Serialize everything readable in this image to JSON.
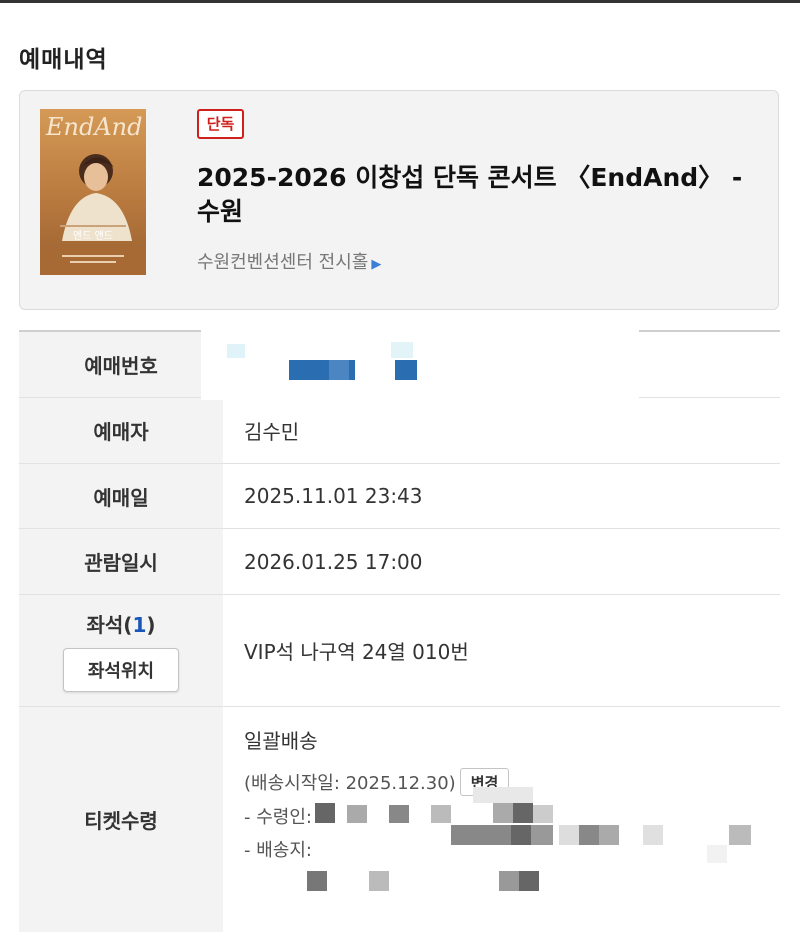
{
  "section_title": "예매내역",
  "event": {
    "badge": "단독",
    "title": "2025-2026 이창섭 단독 콘서트 〈EndAnd〉 - 수원",
    "venue": "수원컨벤션센터 전시홀",
    "poster_text": "EndAnd",
    "poster_caption": "엔드 앤드"
  },
  "details": {
    "booking_number_label": "예매번호",
    "booker_label": "예매자",
    "booker_value": "김수민",
    "booking_date_label": "예매일",
    "booking_date_value": "2025.11.01 23:43",
    "viewing_label": "관람일시",
    "viewing_value": "2026.01.25 17:00",
    "seat_label": "좌석(",
    "seat_count": "1",
    "seat_label_close": ")",
    "seat_position_button": "좌석위치",
    "seat_value": "VIP석 나구역 24열 010번",
    "ticket_label": "티켓수령",
    "delivery_method": "일괄배송",
    "delivery_start": "(배송시작일: 2025.12.30)",
    "change_button": "변경",
    "recipient_label": "- 수령인:",
    "address_label": "- 배송지:"
  },
  "colors": {
    "badge_red": "#d0201c",
    "link_blue": "#3b7ed8",
    "label_bg": "#f3f3f3",
    "mosaic_blue": "#2a6db0"
  }
}
